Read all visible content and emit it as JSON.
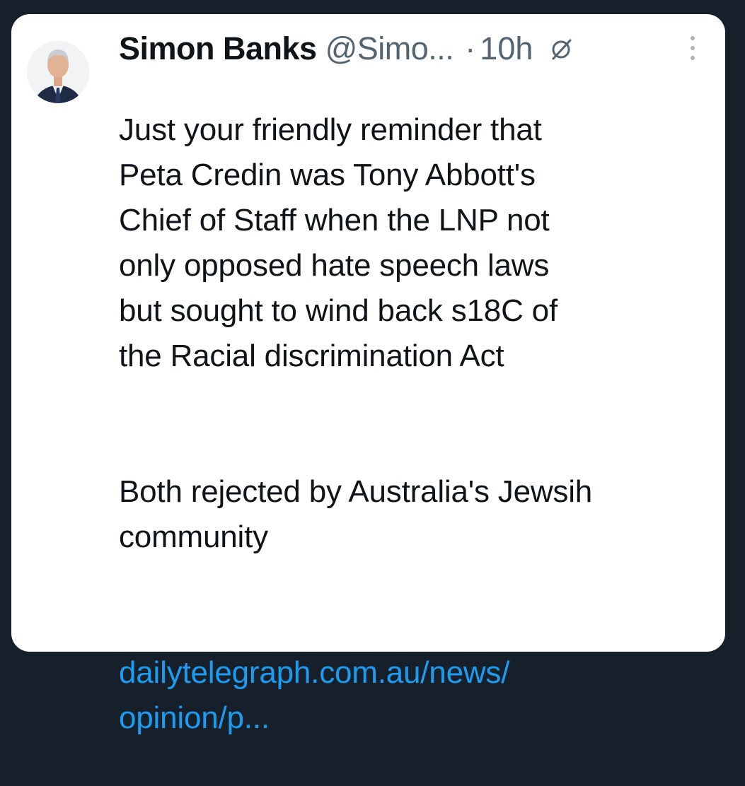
{
  "tweet": {
    "author_name": "Simon Banks",
    "handle": "@Simo...",
    "separator": "·",
    "time": "10h",
    "body_paragraph_1": "Just your friendly reminder that\nPeta Credin was Tony Abbott's\nChief of Staff when the LNP not\nonly opposed hate speech laws\nbut sought to wind back s18C of\nthe Racial discrimination Act",
    "body_paragraph_2": "Both rejected by Australia's Jewsih\ncommunity",
    "link_text": "dailytelegraph.com.au/news/\nopinion/p..."
  },
  "icons": {
    "grok": "grok-icon",
    "more": "more-options-icon",
    "avatar": "avatar"
  },
  "colors": {
    "page_background": "#15202b",
    "card_background": "#ffffff",
    "primary_text": "#0f1419",
    "secondary_text": "#536471",
    "link": "#1d9bf0"
  }
}
